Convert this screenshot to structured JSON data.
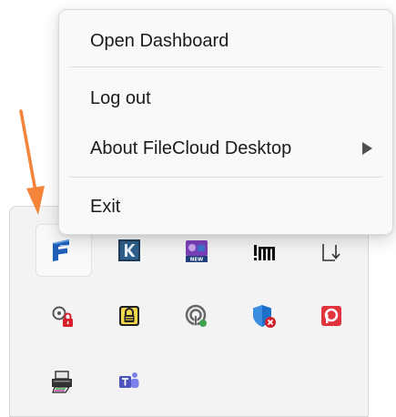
{
  "context_menu": {
    "items": [
      {
        "label": "Open Dashboard"
      },
      {
        "label": "Log out"
      },
      {
        "label": "About FileCloud Desktop",
        "has_submenu": true
      },
      {
        "label": "Exit"
      }
    ]
  },
  "tray": {
    "icons": [
      {
        "icon": "filecloud-icon",
        "highlighted": true
      },
      {
        "icon": "k-app-icon"
      },
      {
        "icon": "new-app-icon"
      },
      {
        "icon": "bars-app-icon"
      },
      {
        "icon": "download-tray-icon"
      },
      {
        "icon": "lock-key-icon"
      },
      {
        "icon": "padlock-icon"
      },
      {
        "icon": "network-status-icon"
      },
      {
        "icon": "security-shield-icon"
      },
      {
        "icon": "red-p-app-icon"
      },
      {
        "icon": "printer-icon"
      },
      {
        "icon": "teams-icon"
      }
    ]
  },
  "colors": {
    "annotation_arrow": "#f4843a",
    "filecloud_blue": "#1e5fb8"
  }
}
